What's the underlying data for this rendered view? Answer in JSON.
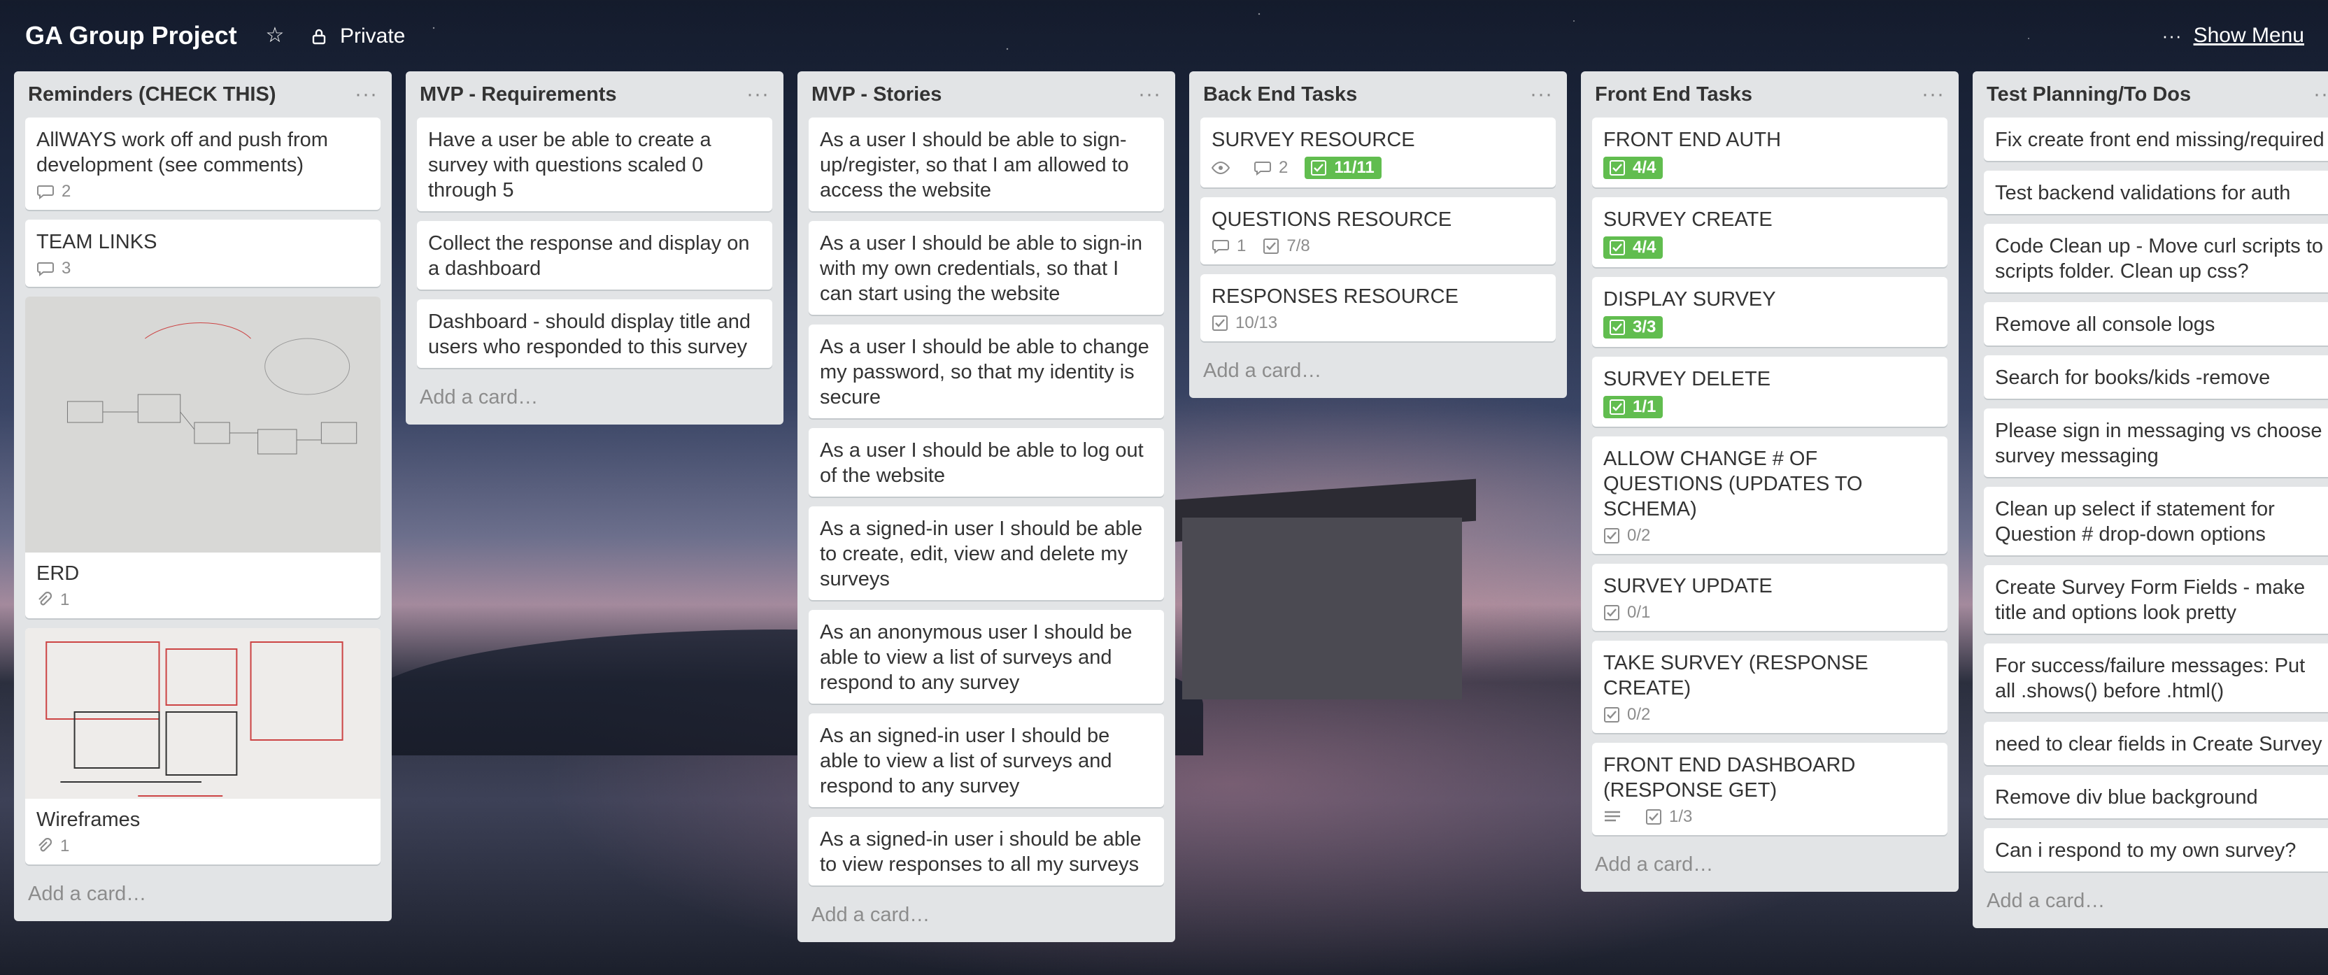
{
  "board": {
    "title": "GA Group Project",
    "privacy": "Private",
    "show_menu": "Show Menu",
    "menu_dots": "···"
  },
  "add_card_label": "Add a card…",
  "list_menu_dots": "···",
  "lists": [
    {
      "title": "Reminders (CHECK THIS)",
      "cards": [
        {
          "title": "AllWAYS work off and push from development (see comments)",
          "comments": "2"
        },
        {
          "title": "TEAM LINKS",
          "comments": "3"
        },
        {
          "title": "ERD",
          "attachments": "1",
          "cover": "whiteboard-erd"
        },
        {
          "title": "Wireframes",
          "attachments": "1",
          "cover": "whiteboard-wireframes"
        }
      ]
    },
    {
      "title": "MVP - Requirements",
      "cards": [
        {
          "title": "Have a user be able to create a survey with questions scaled 0 through 5"
        },
        {
          "title": "Collect the response and display on a dashboard"
        },
        {
          "title": "Dashboard - should display title and users who responded to this survey"
        }
      ]
    },
    {
      "title": "MVP - Stories",
      "cards": [
        {
          "title": "As a user I should be able to sign-up/register, so that I am allowed to access the website"
        },
        {
          "title": "As a user I should be able to sign-in with my own credentials, so that I can start using the website"
        },
        {
          "title": "As a user I should be able to change my password, so that my identity is secure"
        },
        {
          "title": "As a user I should be able to log out of the website"
        },
        {
          "title": "As a signed-in user I should be able to create, edit, view and delete my surveys"
        },
        {
          "title": "As an anonymous user I should be able to view a list of surveys and respond to any survey"
        },
        {
          "title": "As an signed-in user I should be able to view a list of surveys and respond to any survey"
        },
        {
          "title": "As a signed-in user i should be able to view responses to all my surveys"
        }
      ]
    },
    {
      "title": "Back End Tasks",
      "cards": [
        {
          "title": "SURVEY RESOURCE",
          "watch": true,
          "comments": "2",
          "checklist": "11/11",
          "checklist_done": true
        },
        {
          "title": "QUESTIONS RESOURCE",
          "comments": "1",
          "checklist": "7/8"
        },
        {
          "title": "RESPONSES RESOURCE",
          "checklist": "10/13"
        }
      ]
    },
    {
      "title": "Front End Tasks",
      "cards": [
        {
          "title": "FRONT END AUTH",
          "checklist": "4/4",
          "checklist_done": true
        },
        {
          "title": "SURVEY CREATE",
          "checklist": "4/4",
          "checklist_done": true
        },
        {
          "title": "DISPLAY SURVEY",
          "checklist": "3/3",
          "checklist_done": true
        },
        {
          "title": "SURVEY DELETE",
          "checklist": "1/1",
          "checklist_done": true
        },
        {
          "title": "ALLOW CHANGE # OF QUESTIONS (UPDATES TO SCHEMA)",
          "checklist": "0/2"
        },
        {
          "title": "SURVEY UPDATE",
          "checklist": "0/1"
        },
        {
          "title": "TAKE SURVEY (RESPONSE CREATE)",
          "checklist": "0/2"
        },
        {
          "title": "FRONT END DASHBOARD (RESPONSE GET)",
          "description": true,
          "checklist": "1/3"
        }
      ]
    },
    {
      "title": "Test Planning/To Dos",
      "cards": [
        {
          "title": "Fix create front end missing/required"
        },
        {
          "title": "Test backend validations for auth"
        },
        {
          "title": "Code Clean up - Move curl scripts to scripts folder. Clean up css?"
        },
        {
          "title": "Remove all console logs"
        },
        {
          "title": "Search for books/kids -remove"
        },
        {
          "title": "Please sign in messaging vs choose survey messaging"
        },
        {
          "title": "Clean up select if statement for Question # drop-down options"
        },
        {
          "title": "Create Survey Form Fields - make title and options look pretty"
        },
        {
          "title": "For success/failure messages: Put all .shows() before .html()"
        },
        {
          "title": "need to clear fields in Create Survey"
        },
        {
          "title": "Remove div blue background"
        },
        {
          "title": "Can i respond to my own survey?"
        }
      ]
    }
  ],
  "colors": {
    "list_bg": "#e2e4e6",
    "badge_complete": "#61bd4f",
    "header_text": "#ffffff"
  }
}
